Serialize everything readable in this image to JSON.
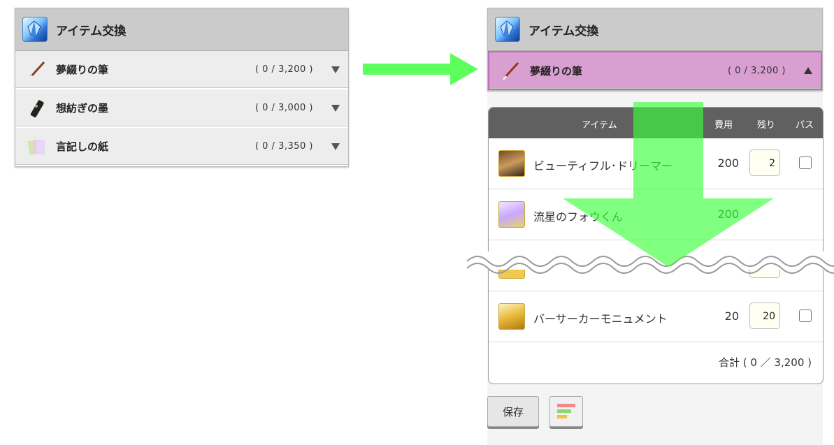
{
  "left_panel": {
    "title": "アイテム交換",
    "items": [
      {
        "name": "夢綴りの筆",
        "count": "( 0 / 3,200 )"
      },
      {
        "name": "想紡ぎの墨",
        "count": "( 0 / 3,000 )"
      },
      {
        "name": "言記しの紙",
        "count": "( 0 / 3,350 )"
      }
    ]
  },
  "right_panel": {
    "title": "アイテム交換",
    "selected": {
      "name": "夢綴りの筆",
      "count": "( 0 / 3,200 )"
    },
    "table": {
      "headers": {
        "item": "アイテム",
        "cost": "費用",
        "remaining": "残り",
        "pass": "パス"
      },
      "rows": [
        {
          "name": "ビューティフル･ドリーマー",
          "cost": "200",
          "remaining": "2"
        },
        {
          "name": "流星のフォウくん",
          "cost": "200",
          "remaining": ""
        },
        {
          "name": "バーサーカーモニュメント",
          "cost": "20",
          "remaining": "20"
        }
      ],
      "total": "合計 ( 0 ／ 3,200 )"
    },
    "save_label": "保存"
  },
  "colors": {
    "active_row": "#d89fd0",
    "arrow": "#5cff5c",
    "header": "#cbcbcb"
  },
  "icons": [
    "crystal-icon",
    "brush-icon",
    "ink-icon",
    "paper-icon",
    "sort-icon"
  ]
}
